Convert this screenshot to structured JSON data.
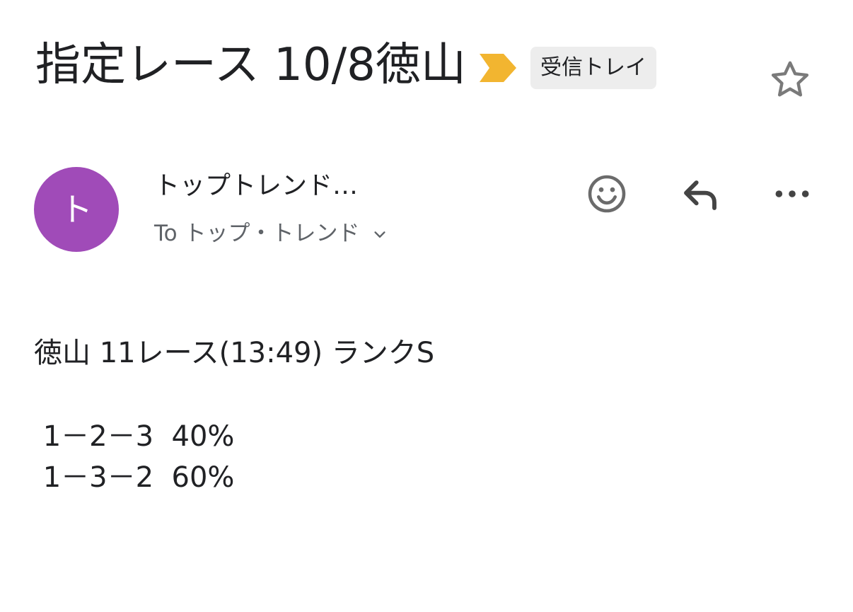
{
  "subject": "指定レース 10/8徳山",
  "label": "受信トレイ",
  "importance_color": "#f2b530",
  "avatar": {
    "initial": "ト",
    "color": "#a04bb8"
  },
  "sender": {
    "name": "トップトレンド…",
    "recipients": "To トップ・トレンド"
  },
  "icons": {
    "star": "star-outline-icon",
    "emoji": "emoji-smile-icon",
    "reply": "reply-arrow-icon",
    "more": "more-horizontal-icon",
    "recipients_expand": "chevron-down-icon"
  },
  "body": {
    "line1": "徳山 11レース(13:49) ランクS",
    "line2": " 1－2－3  40%",
    "line3": " 1－3－2  60%"
  }
}
